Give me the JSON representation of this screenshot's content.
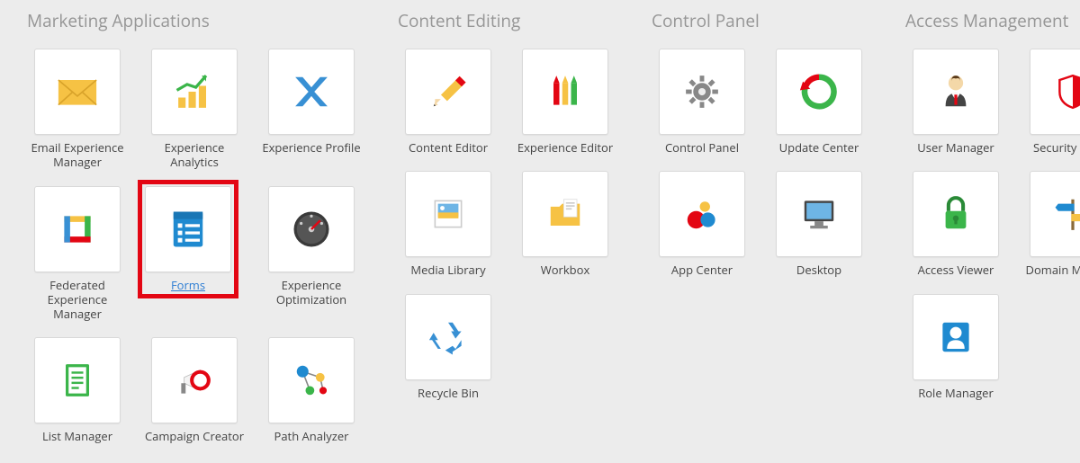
{
  "sections": {
    "marketing": {
      "title": "Marketing Applications",
      "tiles": {
        "email_experience_manager": "Email Experience Manager",
        "experience_analytics": "Experience Analytics",
        "experience_profile": "Experience Profile",
        "federated_experience_manager": "Federated Experience Manager",
        "forms": "Forms",
        "experience_optimization": "Experience Optimization",
        "list_manager": "List Manager",
        "campaign_creator": "Campaign Creator",
        "path_analyzer": "Path Analyzer"
      }
    },
    "content_editing": {
      "title": "Content Editing",
      "tiles": {
        "content_editor": "Content Editor",
        "experience_editor": "Experience Editor",
        "media_library": "Media Library",
        "workbox": "Workbox",
        "recycle_bin": "Recycle Bin"
      }
    },
    "control_panel": {
      "title": "Control Panel",
      "tiles": {
        "control_panel": "Control Panel",
        "update_center": "Update Center",
        "app_center": "App Center",
        "desktop": "Desktop"
      }
    },
    "access_management": {
      "title": "Access Management",
      "tiles": {
        "user_manager": "User Manager",
        "security_editor": "Security Editor",
        "access_viewer": "Access Viewer",
        "domain_manager": "Domain Manager",
        "role_manager": "Role Manager"
      }
    }
  },
  "highlighted_tile": "forms"
}
